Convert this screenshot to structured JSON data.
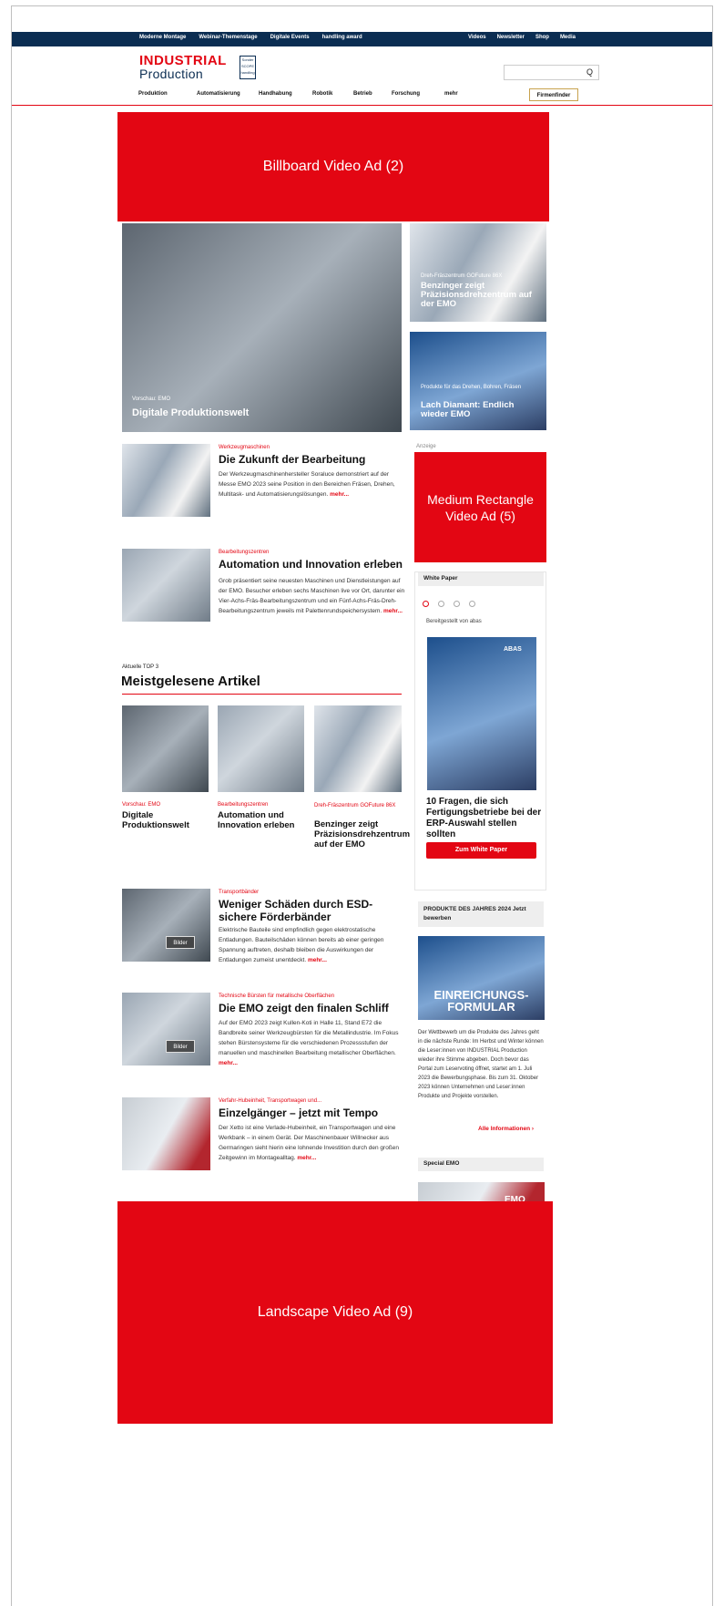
{
  "topnav": {
    "links": [
      "Moderne Montage",
      "Webinar-Themenstage",
      "Digitale Events",
      "handling award"
    ],
    "right": [
      "Videos",
      "Newsletter",
      "Shop",
      "Media"
    ]
  },
  "logo": {
    "line1": "INDUSTRIAL",
    "line2": "Production",
    "badge": "Sonder SCOPE handling"
  },
  "search": {
    "icon": "Q"
  },
  "mainnav": [
    "Produktion",
    "Automatisierung",
    "Handhabung",
    "Robotik",
    "Betrieb",
    "Forschung",
    "mehr"
  ],
  "firmenfinder": "Firmenfinder",
  "ads": {
    "billboard": "Billboard Video Ad (2)",
    "medium": "Medium Rectangle Video Ad (5)",
    "landscape": "Landscape Video Ad (9)",
    "anzeige": "Anzeige"
  },
  "hero": {
    "main": {
      "kicker": "Vorschau: EMO",
      "title": "Digitale Produktionswelt"
    },
    "side1": {
      "kicker": "Dreh-Fräszentrum GOFuture 86X",
      "title": "Benzinger zeigt Präzisionsdrehzentrum auf der EMO"
    },
    "side2": {
      "kicker": "Produkte für das Drehen, Bohren, Fräsen",
      "title": "Lach Diamant: Endlich wieder EMO"
    }
  },
  "articles": [
    {
      "kicker": "Werkzeugmaschinen",
      "title": "Die Zukunft der Bearbeitung",
      "text": "Der Werkzeugmaschinenhersteller Soraluce demonstriert auf der Messe EMO 2023 seine Position in den Bereichen Fräsen, Drehen, Multitask- und Automatisierungslösungen.",
      "more": "mehr..."
    },
    {
      "kicker": "Bearbeitungszentren",
      "title": "Automation und Innovation erleben",
      "text": "Grob präsentiert seine neuesten Maschinen und Dienstleistungen auf der EMO. Besucher erleben sechs Maschinen live vor Ort, darunter ein Vier-Achs-Fräs-Bearbeitungszentrum und ein Fünf-Achs-Fräs-Dreh-Bearbeitungszentrum jeweils mit Palettenrundspeichersystem.",
      "more": "mehr..."
    }
  ],
  "top3": {
    "label": "Aktuelle TOP 3",
    "title": "Meistgelesene Artikel",
    "items": [
      {
        "kicker": "Vorschau: EMO",
        "title": "Digitale Produktionswelt"
      },
      {
        "kicker": "Bearbeitungszentren",
        "title": "Automation und Innovation erleben"
      },
      {
        "kicker": "Dreh-Fräszentrum GOFuture 86X",
        "title": "Benzinger zeigt Präzisionsdrehzentrum auf der EMO"
      }
    ]
  },
  "articles2": [
    {
      "kicker": "Transportbänder",
      "title": "Weniger Schäden durch ESD-sichere Förderbänder",
      "text": "Elektrische Bauteile sind empfindlich gegen elektrostatische Entladungen. Bauteilschäden können bereits ab einer geringen Spannung auftreten, deshalb bleiben die Auswirkungen der Entladungen zumeist unentdeckt.",
      "more": "mehr...",
      "badge": "Bilder"
    },
    {
      "kicker": "Technische Bürsten für metallische Oberflächen",
      "title": "Die EMO zeigt den finalen Schliff",
      "text": "Auf der EMO 2023 zeigt Kullen-Koti in Halle 11, Stand E72 die Bandbreite seiner Werkzeugbürsten für die Metallindustrie. Im Fokus stehen Bürstensysteme für die verschiedenen Prozessstufen der manuellen und maschinellen Bearbeitung metallischer Oberflächen.",
      "more": "mehr...",
      "badge": "Bilder"
    },
    {
      "kicker": "Verfahr-Hubeinheit, Transportwagen und...",
      "title": "Einzelgänger – jetzt mit Tempo",
      "text": "Der Xetto ist eine Verlade-Hubeinheit, ein Transportwagen und eine Werkbank – in einem Gerät. Der Maschinenbauer Willnecker aus Germaringen sieht hierin eine lohnende Investition durch den großen Zeitgewinn im Montagealltag.",
      "more": "mehr..."
    }
  ],
  "whitepaper": {
    "head": "White Paper",
    "provided": "Bereitgestellt von abas",
    "brand": "ABAS",
    "title": "10 Fragen, die sich Fertigungsbetriebe bei der ERP-Auswahl stellen sollten",
    "button": "Zum White Paper"
  },
  "produkte": {
    "head": "PRODUKTE DES JAHRES 2024 Jetzt bewerben",
    "banner": "EINREICHUNGS-FORMULAR",
    "text": "Der Wettbewerb um die Produkte des Jahres geht in die nächste Runde: Im Herbst und Winter können die Leser:innen von INDUSTRIAL Production wieder ihre Stimme abgeben. Doch bevor das Portal zum Leservoting öffnet, startet am 1. Juli 2023 die Bewerbungsphase. Bis zum 31. Oktober 2023 können Unternehmen und Leser:innen Produkte und Projekte vorstellen.",
    "link": "Alle Informationen"
  },
  "special": {
    "head": "Special EMO",
    "banner": "EMO"
  }
}
